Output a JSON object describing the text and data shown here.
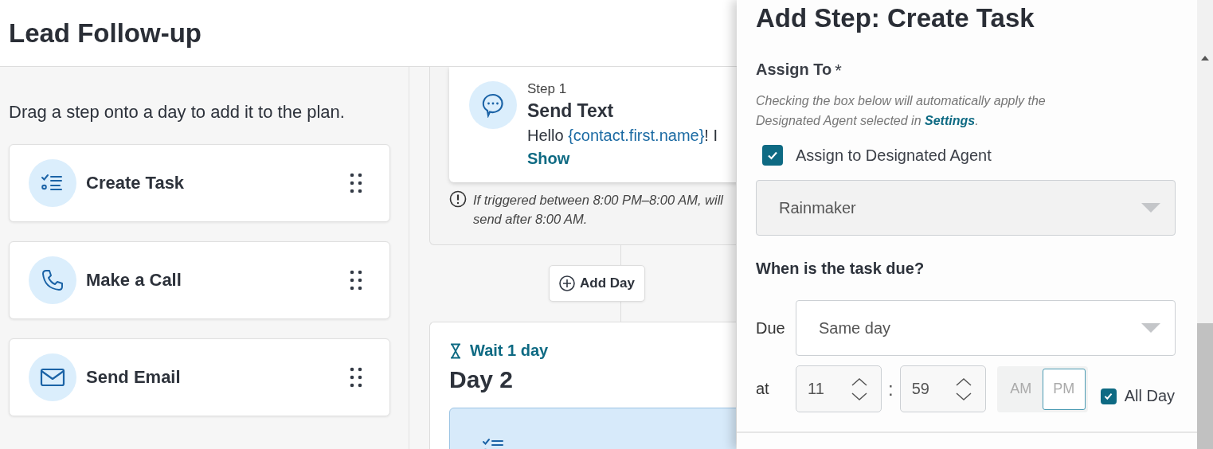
{
  "header": {
    "title": "Lead Follow-up"
  },
  "steps_panel": {
    "hint": "Drag a step onto a day to add it to the plan.",
    "steps": [
      {
        "kind": "task",
        "label": "Create Task"
      },
      {
        "kind": "call",
        "label": "Make a Call"
      },
      {
        "kind": "email",
        "label": "Send Email"
      }
    ]
  },
  "plan": {
    "day1": {
      "step": {
        "kind": "text",
        "number": "Step 1",
        "title": "Send Text",
        "message": [
          {
            "kind": "text",
            "text": "Hello "
          },
          {
            "kind": "variable",
            "text": "{contact.first.name}"
          },
          {
            "kind": "text",
            "text": "! I"
          }
        ],
        "show_link": "Show"
      },
      "notice": "If triggered between 8:00 PM–8:00 AM, will send after 8:00 AM."
    },
    "add_day": "Add Day",
    "day2": {
      "wait": "Wait 1 day",
      "title": "Day 2",
      "step": {
        "kind": "task"
      }
    }
  },
  "drawer": {
    "title": "Add Step: Create Task",
    "assign_label": "Assign To",
    "required_mark": "*",
    "help": "Checking the box below will automatically apply the Designated Agent selected in ",
    "help_link": "Settings",
    "help_end": ".",
    "designated": {
      "label": "Assign to Designated Agent",
      "checked": true
    },
    "agent_select": {
      "value": "Rainmaker",
      "disabled": true
    },
    "due_heading": "When is the task due?",
    "due_label": "Due",
    "due_select": {
      "value": "Same day",
      "disabled": false
    },
    "at_label": "at",
    "hour": "11",
    "separator": ":",
    "minute": "59",
    "meridiem": [
      {
        "label": "AM",
        "selected": false
      },
      {
        "label": "PM",
        "selected": true
      }
    ],
    "all_day": {
      "label": "All Day",
      "checked": true
    }
  }
}
